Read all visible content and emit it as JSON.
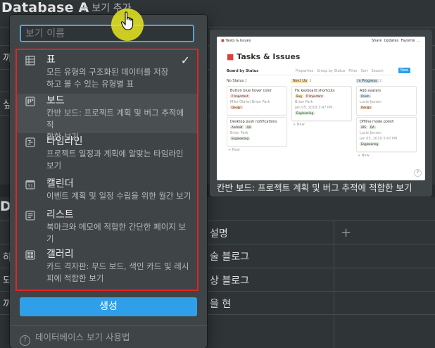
{
  "page": {
    "title": "Database A",
    "add_view_label": "보기 추가",
    "left_clipped": [
      "까",
      "싶",
      "하",
      "되",
      "끼"
    ],
    "section_letter": "D",
    "table_header_right": "설명",
    "table_cells_right": [
      "술 블로그",
      "상 블로그",
      "을 현"
    ]
  },
  "popup": {
    "name_placeholder": "보기 이름",
    "views": [
      {
        "name": "표",
        "description": "모든 유형의 구조화된 데이터를 저장하고 볼 수 있는 유형별 표",
        "icon": "table-icon",
        "selected": true
      },
      {
        "name": "보드",
        "description": "칸반 보드: 프로젝트 계획 및 버그 추적에 적합한 보기",
        "icon": "board-icon",
        "selected": false
      },
      {
        "name": "타임라인",
        "description": "프로젝트 일정과 계획에 알맞는 타임라인 보기",
        "icon": "timeline-icon",
        "selected": false
      },
      {
        "name": "캘린더",
        "description": "이벤트 계획 및 일정 수립을 위한 월간 보기",
        "icon": "calendar-icon",
        "selected": false
      },
      {
        "name": "리스트",
        "description": "북마크와 메모에 적합한 간단한 페이지 보기",
        "icon": "list-icon",
        "selected": false
      },
      {
        "name": "갤러리",
        "description": "카드 격자판: 무드 보드, 색인 카드 및 레시피에 적합한 보기",
        "icon": "gallery-icon",
        "selected": false
      }
    ],
    "desc_lines": [
      [
        "모든 유형의 구조화된 데이터를 저장",
        "하고 볼 수 있는 유형별 표"
      ],
      [
        "칸반 보드: 프로젝트 계획 및 버그 추적에 적",
        "합한 보기"
      ],
      [
        "프로젝트 일정과 계획에 알맞는 타임라인",
        "보기"
      ],
      [
        "이벤트 계획 및 일정 수립을 위한 월간 보기"
      ],
      [
        "북마크와 메모에 적합한 간단한 페이지 보기"
      ],
      [
        "카드 격자판: 무드 보드, 색인 카드 및 레시",
        "피에 적합한 보기"
      ]
    ],
    "create_label": "생성",
    "help_label": "데이터베이스 보기 사용법"
  },
  "preview": {
    "caption": "칸반 보드: 프로젝트 계획 및 버그 추적에 적합한 보기",
    "mock": {
      "breadcrumb": "Tasks & Issues",
      "top_actions": [
        "Share",
        "Updates",
        "Favorite",
        "..."
      ],
      "title": "Tasks & Issues",
      "view_selector": "Board by Status",
      "toolbar": [
        "Properties",
        "Group by Status",
        "Filter",
        "Sort",
        "Search",
        "New"
      ],
      "columns": [
        {
          "name": "No Status",
          "count": "2",
          "cards": [
            {
              "title": "Button blue hover color",
              "tags": [
                "P Important"
              ],
              "people": "Mike Olafsri  Brian Park",
              "label": "Design"
            },
            {
              "title": "Desktop push notifications",
              "tags": [
                "Android",
                "QA"
              ],
              "people": "Brian Park",
              "label": "Engineering"
            }
          ]
        },
        {
          "name": "Next Up",
          "count": "1",
          "cards": [
            {
              "title": "Fix keyboard shortcuts",
              "tags": [
                "Bug",
                "P Important"
              ],
              "people": "Brian Park",
              "date": "Jan 05, 2019 3:47 PM",
              "label": "Engineering"
            }
          ]
        },
        {
          "name": "In Progress",
          "count": "2",
          "cards": [
            {
              "title": "Add avatars",
              "tags": [
                "Polish"
              ],
              "people": "Lucie Jensen",
              "label": "Design"
            },
            {
              "title": "Offline mode polish",
              "tags": [
                "iOS",
                "QA"
              ],
              "people": "Lucie Jensen",
              "date": "Jan 05, 2019 3:47 PM",
              "label": "Engineering"
            }
          ]
        }
      ],
      "new_label": "+ New",
      "help_mark": "?"
    }
  },
  "colors": {
    "accent": "#2e9fe8",
    "highlight_frame": "#e02424",
    "input_focus": "#5aa1d6",
    "cursor_halo": "#e8e81e"
  }
}
